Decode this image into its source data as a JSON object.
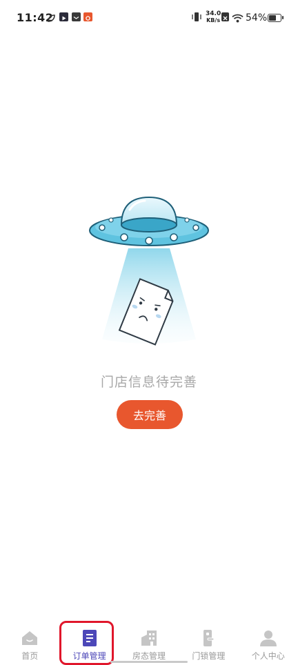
{
  "status_bar": {
    "time": "11:42",
    "net_speed_value": "34.0",
    "net_speed_unit": "KB/s",
    "battery_percent": "54%",
    "battery_level": 0.54
  },
  "empty_state": {
    "message": "门店信息待完善",
    "button_label": "去完善"
  },
  "tab_bar": {
    "active_index": 1,
    "tabs": [
      {
        "label": "首页",
        "icon": "home-icon"
      },
      {
        "label": "订单管理",
        "icon": "order-list-icon"
      },
      {
        "label": "房态管理",
        "icon": "building-icon"
      },
      {
        "label": "门锁管理",
        "icon": "door-lock-icon"
      },
      {
        "label": "个人中心",
        "icon": "person-icon"
      }
    ]
  },
  "colors": {
    "accent": "#e8572e",
    "active_tab": "#4c47b8",
    "inactive_tab": "#9a9a9a",
    "highlight": "#e0162b"
  }
}
